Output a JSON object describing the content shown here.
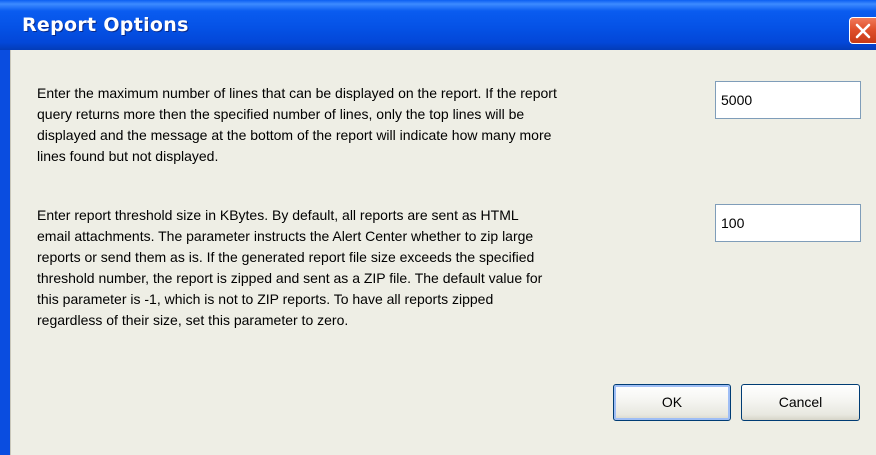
{
  "window": {
    "title": "Report Options"
  },
  "max_lines": {
    "description": "Enter the maximum number of lines that can be displayed on the report. If the report\nquery returns more then the specified number of lines, only the top lines will be\ndisplayed and the message at the bottom of the report will indicate how many more\nlines found but not displayed.",
    "value": "5000"
  },
  "threshold": {
    "description": "Enter report threshold size in KBytes. By default, all reports are sent as HTML\nemail attachments. The parameter instructs the Alert Center whether to zip large\nreports or send them as is. If the generated report file size exceeds the specified\nthreshold number, the report is zipped and sent as a ZIP file. The default value for\nthis parameter is -1, which is not to ZIP reports. To have all reports zipped\nregardless of their size, set this parameter to zero.",
    "value": "100"
  },
  "buttons": {
    "ok_label": "OK",
    "cancel_label": "Cancel"
  },
  "icons": {
    "close": "close-icon"
  },
  "colors": {
    "titlebar": "#0552e6",
    "close_button": "#e0512c",
    "dialog_background": "#eeeee5",
    "field_border": "#7f9db9"
  }
}
